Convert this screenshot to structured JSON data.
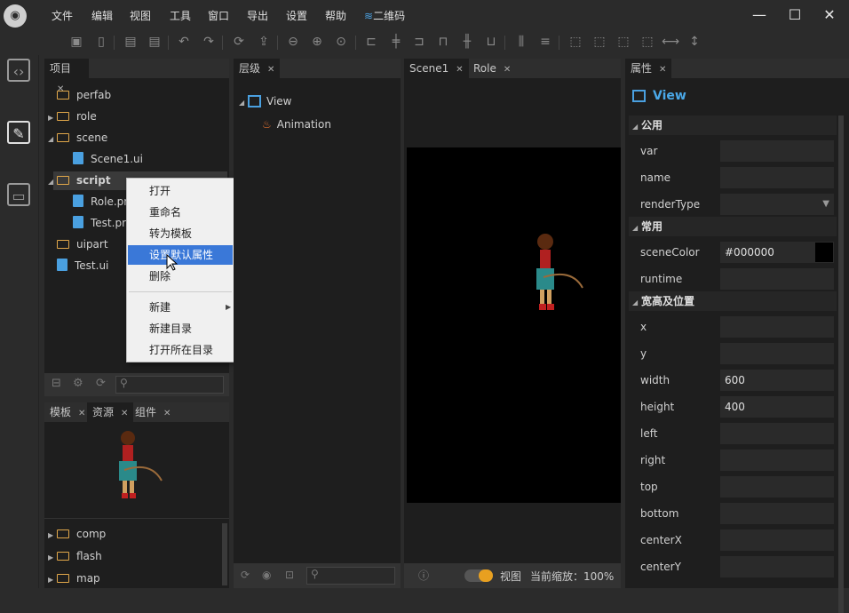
{
  "menubar": {
    "items": [
      "文件",
      "编辑",
      "视图",
      "工具",
      "窗口",
      "导出",
      "设置",
      "帮助"
    ],
    "qr_label": "二维码"
  },
  "window": {
    "minimize": "—",
    "maximize": "☐",
    "close": "✕"
  },
  "project_panel": {
    "tab_label": "项目",
    "tree": [
      {
        "label": "perfab",
        "kind": "folder",
        "indent": 1,
        "arrow": ""
      },
      {
        "label": "role",
        "kind": "folder",
        "indent": 1,
        "arrow": "▶"
      },
      {
        "label": "scene",
        "kind": "folder",
        "indent": 1,
        "arrow": "◢"
      },
      {
        "label": "Scene1.ui",
        "kind": "file",
        "indent": 2,
        "arrow": ""
      },
      {
        "label": "script",
        "kind": "folder",
        "indent": 1,
        "arrow": "◢"
      },
      {
        "label": "Role.pr",
        "kind": "file",
        "indent": 2,
        "arrow": ""
      },
      {
        "label": "Test.pr",
        "kind": "file",
        "indent": 2,
        "arrow": ""
      },
      {
        "label": "uipart",
        "kind": "folder",
        "indent": 1,
        "arrow": ""
      },
      {
        "label": "Test.ui",
        "kind": "file",
        "indent": 1,
        "arrow": ""
      }
    ]
  },
  "context_menu": {
    "items": [
      "打开",
      "重命名",
      "转为模板",
      "设置默认属性",
      "删除"
    ],
    "items2": [
      "新建",
      "新建目录",
      "打开所在目录"
    ],
    "highlighted": "设置默认属性"
  },
  "bottom_left": {
    "tabs": [
      "模板",
      "资源",
      "组件"
    ],
    "tree": [
      "comp",
      "flash",
      "map"
    ]
  },
  "layer_panel": {
    "tab_label": "层级",
    "root": "View",
    "child": "Animation"
  },
  "scene_panel": {
    "tabs": [
      "Scene1",
      "Role"
    ],
    "view_label": "视图",
    "zoom_label": "当前缩放：100%"
  },
  "props_panel": {
    "tab_label": "属性",
    "title": "View",
    "sections": [
      {
        "name": "公用",
        "rows": [
          {
            "label": "var",
            "value": ""
          },
          {
            "label": "name",
            "value": ""
          },
          {
            "label": "renderType",
            "value": "",
            "dropdown": true
          }
        ]
      },
      {
        "name": "常用",
        "rows": [
          {
            "label": "sceneColor",
            "value": "#000000",
            "swatch": "#000000"
          },
          {
            "label": "runtime",
            "value": ""
          }
        ]
      },
      {
        "name": "宽高及位置",
        "rows": [
          {
            "label": "x",
            "value": ""
          },
          {
            "label": "y",
            "value": ""
          },
          {
            "label": "width",
            "value": "600"
          },
          {
            "label": "height",
            "value": "400"
          },
          {
            "label": "left",
            "value": ""
          },
          {
            "label": "right",
            "value": ""
          },
          {
            "label": "top",
            "value": ""
          },
          {
            "label": "bottom",
            "value": ""
          },
          {
            "label": "centerX",
            "value": ""
          },
          {
            "label": "centerY",
            "value": ""
          }
        ]
      }
    ]
  },
  "colors": {
    "accent": "#3a78d8",
    "folder": "#e2a84a",
    "file": "#4aa0e0",
    "toggle": "#e8a020"
  }
}
